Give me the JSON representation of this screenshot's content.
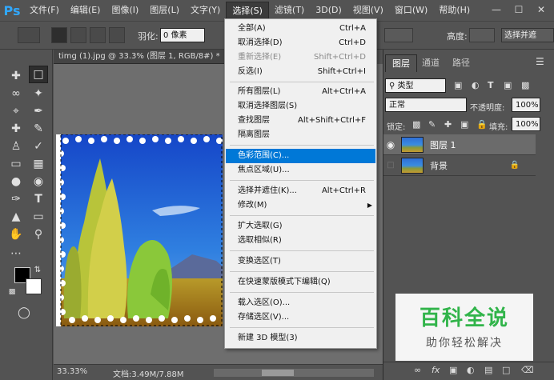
{
  "menubar": {
    "logo": "Ps",
    "items": [
      "文件(F)",
      "编辑(E)",
      "图像(I)",
      "图层(L)",
      "文字(Y)",
      "选择(S)",
      "滤镜(T)",
      "3D(D)",
      "视图(V)",
      "窗口(W)",
      "帮助(H)"
    ],
    "active_index": 5
  },
  "options": {
    "feather_label": "羽化:",
    "feather_value": "0 像素",
    "height_label": "高度:",
    "select_and_mask": "选择并遮"
  },
  "document": {
    "tab_title": "timg (1).jpg @ 33.3% (图层 1, RGB/8#) *",
    "zoom": "33.33%",
    "doc_size": "文档:3.49M/7.88M"
  },
  "panel": {
    "tabs": [
      "图层",
      "通道",
      "路径"
    ],
    "filter_kind": "类型",
    "blend_mode": "正常",
    "opacity_label": "不透明度:",
    "opacity_value": "100%",
    "lock_label": "锁定:",
    "fill_label": "填充:",
    "fill_value": "100%",
    "layers": [
      {
        "name": "图层 1"
      },
      {
        "name": "背景"
      }
    ]
  },
  "select_menu": {
    "items": [
      {
        "label": "全部(A)",
        "shortcut": "Ctrl+A"
      },
      {
        "label": "取消选择(D)",
        "shortcut": "Ctrl+D"
      },
      {
        "label": "重新选择(E)",
        "shortcut": "Shift+Ctrl+D"
      },
      {
        "label": "反选(I)",
        "shortcut": "Shift+Ctrl+I"
      },
      {
        "label": "所有图层(L)",
        "shortcut": "Alt+Ctrl+A"
      },
      {
        "label": "取消选择图层(S)",
        "shortcut": ""
      },
      {
        "label": "查找图层",
        "shortcut": "Alt+Shift+Ctrl+F"
      },
      {
        "label": "隔离图层",
        "shortcut": ""
      },
      {
        "label": "色彩范围(C)...",
        "shortcut": ""
      },
      {
        "label": "焦点区域(U)...",
        "shortcut": ""
      },
      {
        "label": "选择并遮住(K)...",
        "shortcut": "Alt+Ctrl+R"
      },
      {
        "label": "修改(M)",
        "shortcut": ""
      },
      {
        "label": "扩大选取(G)",
        "shortcut": ""
      },
      {
        "label": "选取相似(R)",
        "shortcut": ""
      },
      {
        "label": "变换选区(T)",
        "shortcut": ""
      },
      {
        "label": "在快速蒙版模式下编辑(Q)",
        "shortcut": ""
      },
      {
        "label": "载入选区(O)...",
        "shortcut": ""
      },
      {
        "label": "存储选区(V)...",
        "shortcut": ""
      },
      {
        "label": "新建 3D 模型(3)",
        "shortcut": ""
      }
    ]
  },
  "watermark": {
    "title": "百科全说",
    "subtitle": "助你轻松解决"
  },
  "colors": {
    "highlight": "#0078d7",
    "ps_blue": "#31a8ff",
    "watermark_green": "#31b44a"
  }
}
